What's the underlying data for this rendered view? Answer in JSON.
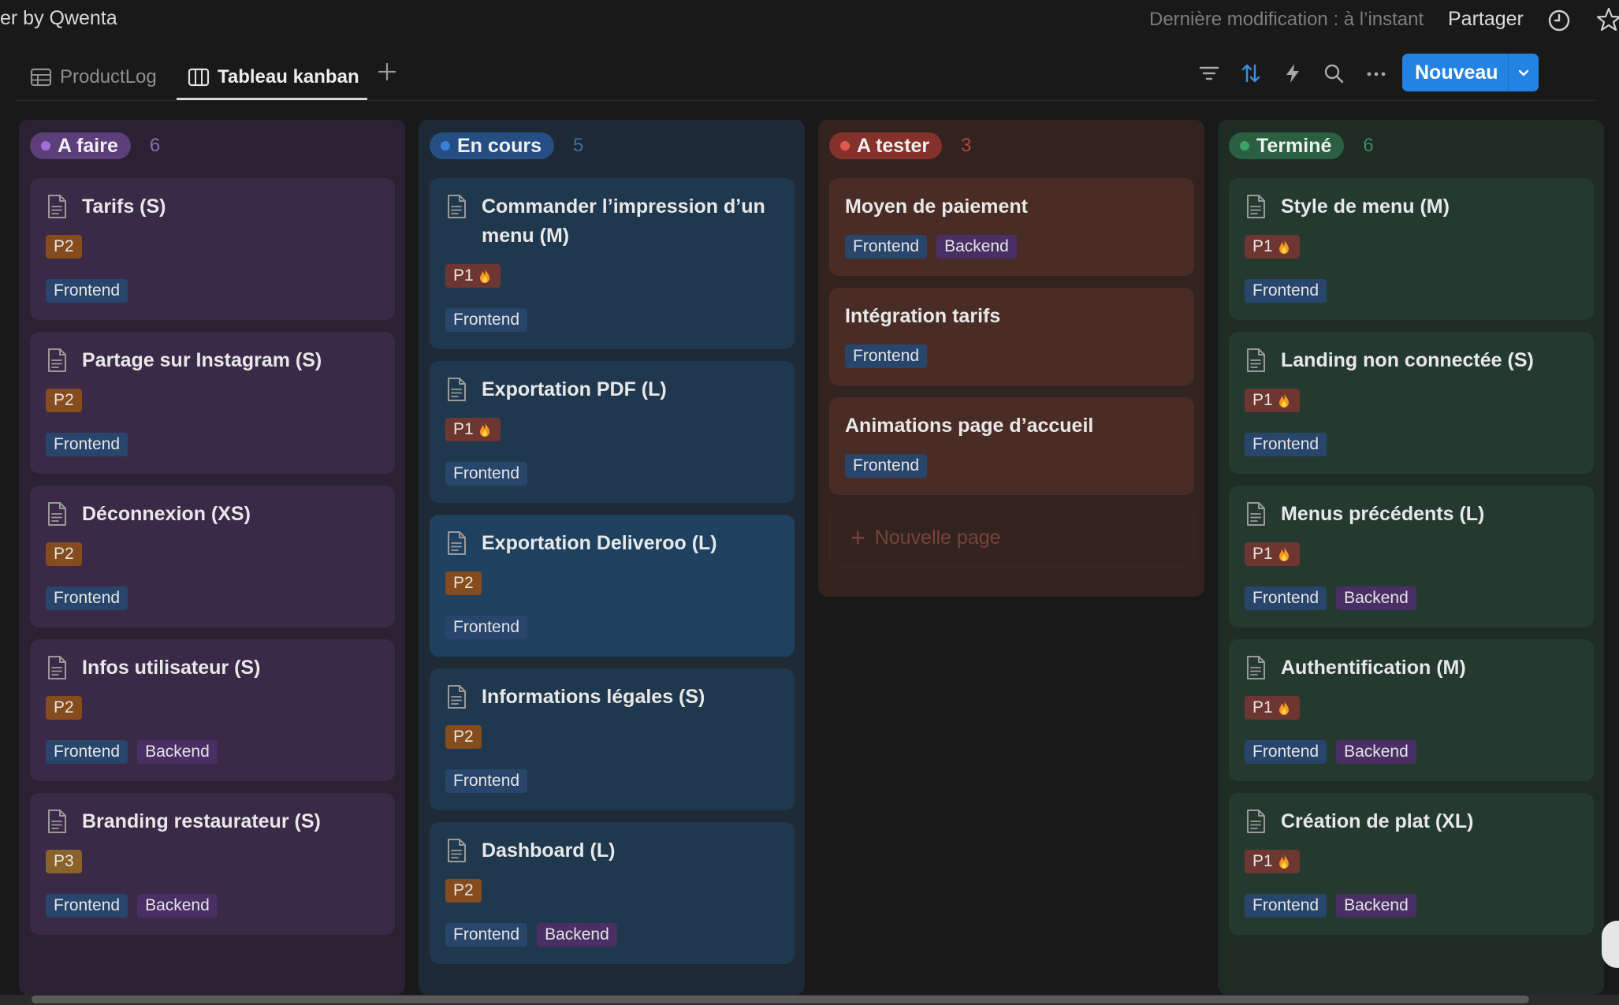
{
  "header": {
    "app_title": "er by Qwenta",
    "last_modified": "Dernière modification : à l’instant",
    "share_label": "Partager",
    "history_icon": "clock-icon",
    "favorite_icon": "star-icon"
  },
  "toolbar": {
    "tabs": [
      {
        "label": "ProductLog",
        "icon": "table-icon",
        "active": false
      },
      {
        "label": "Tableau kanban",
        "icon": "board-icon",
        "active": true
      }
    ],
    "add_view_icon": "plus-icon",
    "tools": [
      "filter-icon",
      "sort-icon",
      "automation-icon",
      "search-icon",
      "more-icon"
    ],
    "new_button_label": "Nouveau"
  },
  "colors": {
    "accent": "#2383e2",
    "todo": "#a16fd6",
    "in_progress": "#3a7fd4",
    "to_test": "#e05a4f",
    "done": "#3fa365"
  },
  "columns": [
    {
      "status": "A faire",
      "count": "6",
      "cards": [
        {
          "title": "Tarifs (S)",
          "tags": [
            "P2",
            "Frontend"
          ]
        },
        {
          "title": "Partage sur Instagram (S)",
          "tags": [
            "P2",
            "Frontend"
          ]
        },
        {
          "title": "Déconnexion (XS)",
          "tags": [
            "P2",
            "Frontend"
          ]
        },
        {
          "title": "Infos utilisateur (S)",
          "tags": [
            "P2",
            "Frontend",
            "Backend"
          ]
        },
        {
          "title": "Branding restaurateur (S)",
          "tags": [
            "P3",
            "Frontend",
            "Backend"
          ]
        }
      ]
    },
    {
      "status": "En cours",
      "count": "5",
      "cards": [
        {
          "title": "Commander l’impression d’un menu (M)",
          "tags": [
            "P1",
            "Frontend"
          ]
        },
        {
          "title": "Exportation PDF (L)",
          "tags": [
            "P1",
            "Frontend"
          ]
        },
        {
          "title": "Exportation Deliveroo (L)",
          "tags": [
            "P2",
            "Frontend"
          ]
        },
        {
          "title": "Informations légales (S)",
          "tags": [
            "P2",
            "Frontend"
          ]
        },
        {
          "title": "Dashboard (L)",
          "tags": [
            "P2",
            "Frontend",
            "Backend"
          ]
        }
      ]
    },
    {
      "status": "A tester",
      "count": "3",
      "cards": [
        {
          "title": "Moyen de paiement",
          "tags": [
            "Frontend",
            "Backend"
          ]
        },
        {
          "title": "Intégration tarifs",
          "tags": [
            "Frontend"
          ]
        },
        {
          "title": "Animations page d’accueil",
          "tags": [
            "Frontend"
          ]
        }
      ],
      "new_page_label": "Nouvelle page"
    },
    {
      "status": "Terminé",
      "count": "6",
      "cards": [
        {
          "title": "Style de menu (M)",
          "tags": [
            "P1",
            "Frontend"
          ]
        },
        {
          "title": "Landing non connectée (S)",
          "tags": [
            "P1",
            "Frontend"
          ]
        },
        {
          "title": "Menus précédents (L)",
          "tags": [
            "P1",
            "Frontend",
            "Backend"
          ]
        },
        {
          "title": "Authentification (M)",
          "tags": [
            "P1",
            "Frontend",
            "Backend"
          ]
        },
        {
          "title": "Création de plat (XL)",
          "tags": [
            "P1",
            "Frontend",
            "Backend"
          ]
        }
      ]
    }
  ]
}
